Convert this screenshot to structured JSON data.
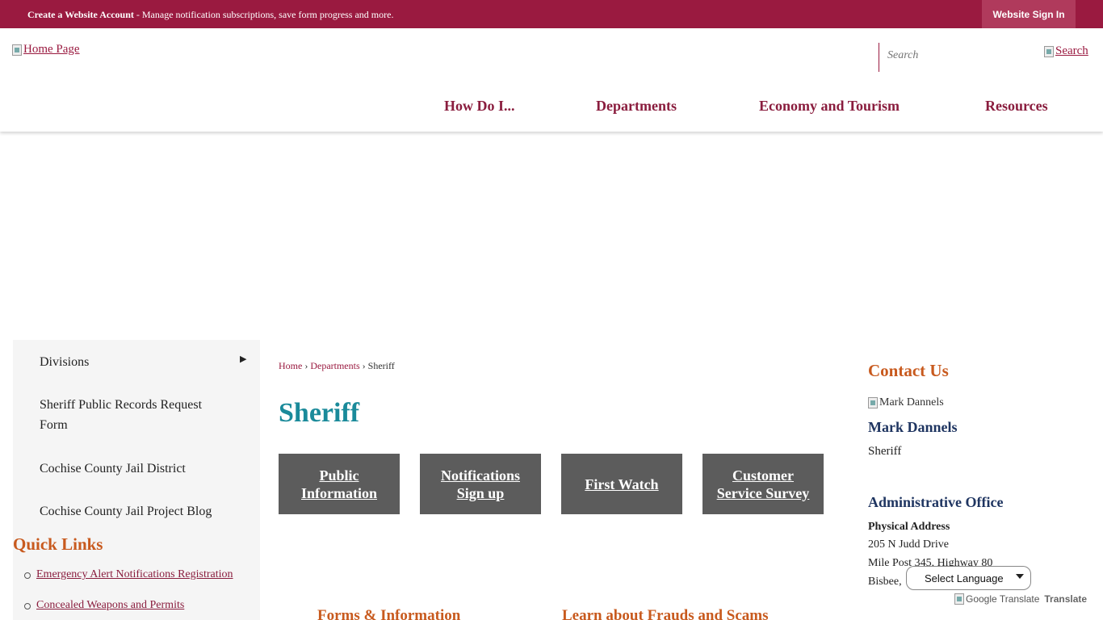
{
  "topbar": {
    "account_link": "Create a Website Account",
    "account_desc": " - Manage notification subscriptions, save form progress and more.",
    "signin": "Website Sign In"
  },
  "header": {
    "logo_alt": "Home Page",
    "search_placeholder": "Search",
    "search_button": "Search",
    "nav": [
      "How Do I...",
      "Departments",
      "Economy and Tourism",
      "Resources"
    ]
  },
  "sidebar": {
    "items": [
      "Divisions",
      "Sheriff Public Records Request Form",
      "Cochise County Jail District",
      "Cochise County Jail Project Blog"
    ],
    "quick_links_title": "Quick Links",
    "quick_links": [
      "Emergency Alert Notifications Registration",
      "Concealed Weapons and Permits"
    ]
  },
  "main": {
    "breadcrumb": [
      "Home",
      "Departments",
      "Sheriff"
    ],
    "title": "Sheriff",
    "tiles": [
      {
        "line1": "Public",
        "line2": "Information"
      },
      {
        "line1": "Notifications",
        "line2": "Sign up"
      },
      {
        "line1": "First Watch",
        "line2": ""
      },
      {
        "line1": "Customer",
        "line2": "Service Survey"
      }
    ],
    "sections": [
      "Forms & Information",
      "Learn about Frauds and Scams"
    ]
  },
  "contact": {
    "title": "Contact Us",
    "img_alt": "Mark Dannels",
    "name": "Mark Dannels",
    "role": "Sheriff",
    "office_title": "Administrative Office",
    "address_label": "Physical Address",
    "address_lines": [
      "205 N Judd Drive",
      "Mile Post 345, Highway 80",
      "Bisbee,"
    ]
  },
  "translate": {
    "select_label": "Select Language",
    "gt_alt": "Google Translate",
    "gt_text": "Translate"
  },
  "colors": {
    "brand": "#9a1a40",
    "accent_orange": "#c85a1e",
    "title_teal": "#1a8a9a",
    "tile_gray": "#5c5c5c",
    "navy": "#1f3561"
  }
}
